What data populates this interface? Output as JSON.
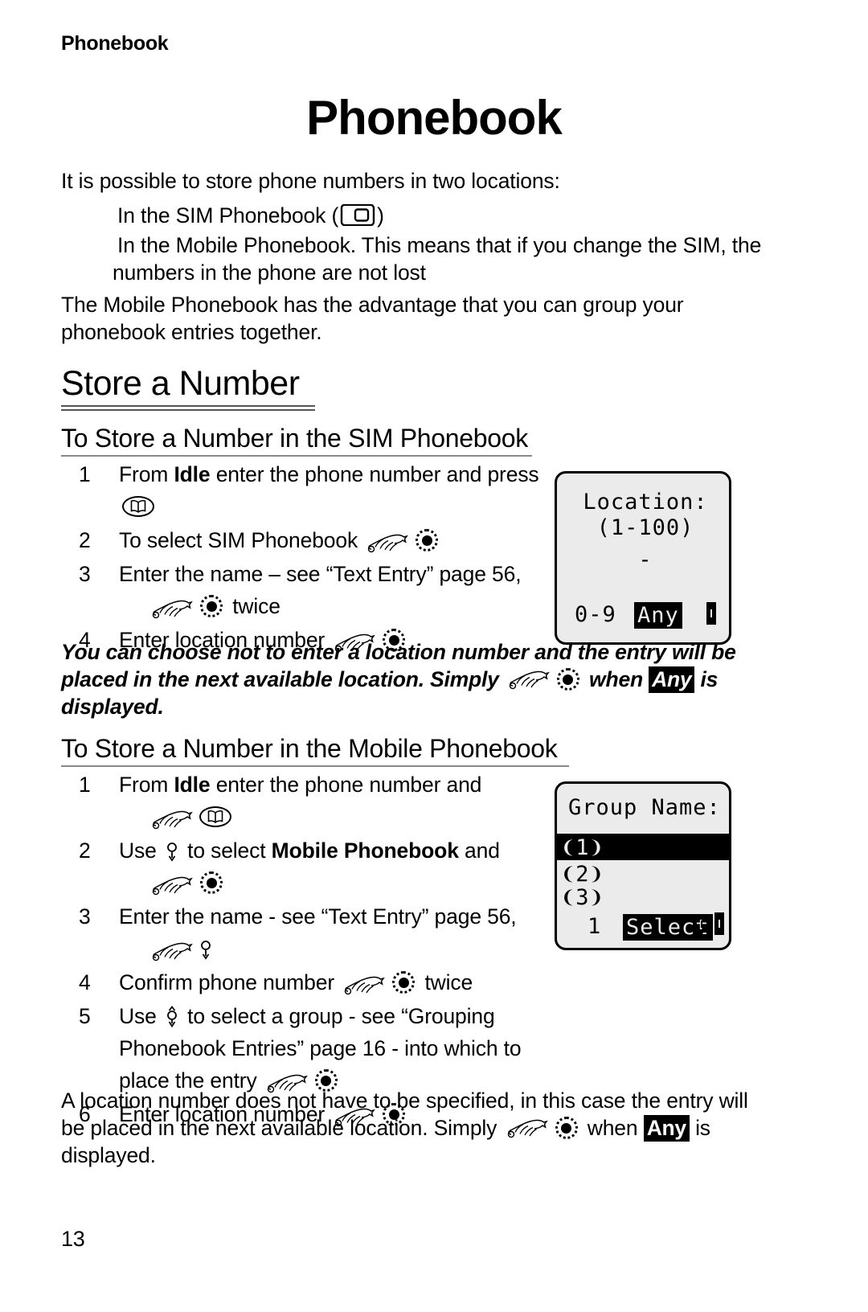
{
  "document": {
    "running_head": "Phonebook",
    "chapter_title": "Phonebook",
    "page_number": "13"
  },
  "intro": {
    "lead": "It is possible to store phone numbers in two locations:",
    "bullet_1_before": "In the SIM Phonebook (",
    "bullet_1_after": ")",
    "bullet_2": "In the Mobile Phonebook. This means that if you change the SIM, the numbers in the phone are not lost",
    "paragraph": "The Mobile Phonebook has the advantage that you can group your phonebook entries together."
  },
  "section": {
    "title": "Store a Number"
  },
  "sim_section": {
    "heading": "To Store a Number in the SIM Phonebook",
    "steps": [
      {
        "num": "1",
        "part_1": "From ",
        "bold": "Idle",
        "part_2": " enter the phone number and press ",
        "icons": [
          "book-key-icon"
        ]
      },
      {
        "num": "2",
        "part_1": "To select SIM Phonebook ",
        "icons": [
          "hand-icon",
          "select-key-icon"
        ]
      },
      {
        "num": "3",
        "part_1": "Enter the name – see “Text Entry” page 56, ",
        "part_2": " twice",
        "icons": [
          "hand-icon",
          "select-key-icon"
        ]
      },
      {
        "num": "4",
        "part_1": "Enter location number ",
        "icons": [
          "hand-icon",
          "select-key-icon"
        ]
      }
    ],
    "note": {
      "part_1": "You can choose not to enter a location number and the entry will be placed in the next available location. Simply ",
      "part_2": " when ",
      "highlight": "Any",
      "part_3": " is displayed."
    }
  },
  "mobile_section": {
    "heading": "To Store a Number in the Mobile Phonebook",
    "steps": [
      {
        "num": "1",
        "part_1": "From ",
        "bold": "Idle",
        "part_2": " enter the phone number and ",
        "icons": [
          "hand-icon",
          "book-key-icon"
        ]
      },
      {
        "num": "2",
        "part_1": "Use ",
        "part_2": " to select ",
        "bold": "Mobile Phonebook",
        "part_3": " and ",
        "icons": [
          "down-key-icon",
          "hand-icon",
          "select-key-icon"
        ]
      },
      {
        "num": "3",
        "part_1": "Enter the name - see “Text Entry” page 56, ",
        "icons": [
          "hand-icon",
          "down-key-icon"
        ]
      },
      {
        "num": "4",
        "part_1": "Confirm phone number ",
        "part_2": " twice",
        "icons": [
          "hand-icon",
          "select-key-icon"
        ]
      },
      {
        "num": "5",
        "part_1": "Use ",
        "part_2": " to select a group - see “Grouping Phonebook Entries” page 16 - into which to place the entry ",
        "icons": [
          "updown-key-icon",
          "hand-icon",
          "select-key-icon"
        ]
      },
      {
        "num": "6",
        "part_1": "Enter location number ",
        "icons": [
          "hand-icon",
          "select-key-icon"
        ]
      }
    ],
    "note": {
      "part_1": "A location number does not have to be specified, in this case the entry will be placed in the next available location. Simply ",
      "part_2": " when ",
      "highlight": "Any",
      "part_3": " is displayed."
    }
  },
  "lcd_location": {
    "line_title": "Location:",
    "line_range": "(1-100)",
    "cursor": "-",
    "softkey_left": "0-9",
    "softkey_center": "Any",
    "battery_icon": "battery-icon"
  },
  "lcd_group": {
    "line_title": "Group Name:",
    "items": [
      "❨1❩",
      "❨2❩",
      "❨3❩"
    ],
    "selected_index": 0,
    "footer_left": "1",
    "softkey_center": "Select",
    "scroll_icon": "up-down-arrows-icon",
    "battery_icon": "battery-icon"
  },
  "colors": {
    "ink": "#000000",
    "paper": "#ffffff",
    "lcd_background": "#ebebeb",
    "rule": "#888888"
  }
}
